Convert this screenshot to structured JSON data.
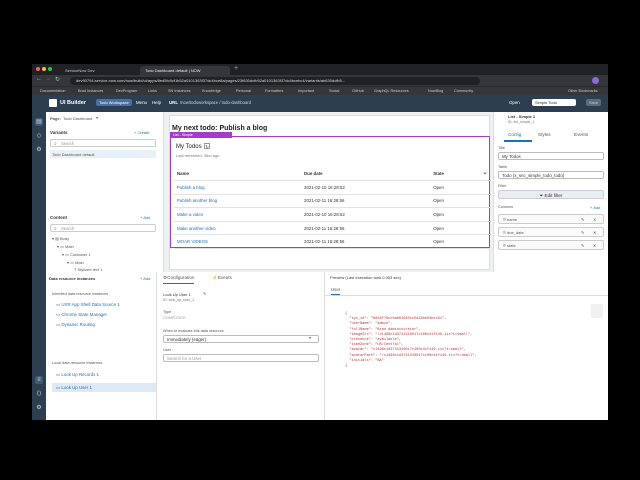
{
  "browser": {
    "tabs": [
      "ServiceNow Dev",
      "Todo Dashboard default | NOW"
    ],
    "url": "dev90794.service-now.com/now/build/ui/apps/8ed5fc9cf1b52a0101363f37dc4bce8a/pages/23f630dcfb52a0101363f37dc4bcebc4/variants/ab630dcfb5...",
    "bookmarks": [
      "Documentation",
      "Brad Instances",
      "DevProgram",
      "Links",
      "SN Instances",
      "Knowledge",
      "Personal",
      "Formatters",
      "Important",
      "Social",
      "GitHub",
      "GraphQL Resources",
      "NowBlog",
      "Community"
    ],
    "other_bookmarks": "Other Bookmarks"
  },
  "app": {
    "title": "UI Builder",
    "workspace": "Todo Workspace",
    "menu": "Menu",
    "help": "Help",
    "url_label": "URL",
    "url_value": "/now/todoworkspace / todo-dashboard",
    "open": "Open",
    "variant": "Simple Todo",
    "save": "Save"
  },
  "left": {
    "page_label": "Page:",
    "page_value": "Todo Dashboard",
    "variants": "Variants",
    "create": "+ Create",
    "search": "Search",
    "variant_item": "Todo Dashboard default",
    "content": "Content",
    "add": "+ Add",
    "tree": [
      "Body",
      "Main",
      "Container 1",
      "Main",
      "Stylized text 1"
    ]
  },
  "canvas": {
    "heading": "My next todo:  Publish a blog",
    "badge": "List - Simple",
    "list_title": "My Todos",
    "refreshed": "Last refreshed: 35m ago",
    "columns": [
      "Name",
      "Due date",
      "State"
    ],
    "rows": [
      [
        "Publish a blog",
        "2021-02-10 16:28:52",
        "Open"
      ],
      [
        "Publish another blog",
        "2021-02-11 16:28:56",
        "Open"
      ],
      [
        "Make a video",
        "2021-02-10 16:28:52",
        "Open"
      ],
      [
        "Make another video",
        "2021-02-11 16:28:56",
        "Open"
      ],
      [
        "MOAR VIDEOS",
        "2021-02-11 16:28:56",
        "Open"
      ]
    ]
  },
  "config": {
    "component": "List - Simple 1",
    "id": "ID: list_simple_1",
    "tabs": [
      "Config",
      "Styles",
      "Events"
    ],
    "title_label": "Title",
    "title_value": "My Todos",
    "table_label": "Table",
    "table_value": "Todo (x_snc_simple_todo_todo)",
    "filter_label": "Filter",
    "edit_filter": "Edit filter",
    "columns_label": "Columns",
    "add": "+ Add",
    "columns": [
      "name",
      "due_date",
      "state"
    ]
  },
  "data": {
    "title": "Data resource instances",
    "add": "+ Add",
    "inherited": "Inherited data resource instances",
    "inherited_items": [
      "UXR App Shell Data Source 1",
      "Chrome State Manager",
      "Dynamic Routing"
    ],
    "local": "Local data resource instances",
    "local_items": [
      "Look Up Records 1",
      "Look Up User 1"
    ]
  },
  "mid": {
    "tabs": [
      "Configuration",
      "Events"
    ],
    "name": "Look Up User 1",
    "id": "ID: look_up_user_1",
    "type_label": "Type",
    "type_value": "COMPOSITE",
    "when_label": "When to evaluate this data resource",
    "when_value": "Immediately (eager)",
    "user_label": "User",
    "user_placeholder": "Search for a User"
  },
  "preview": {
    "title": "Preview (Last execution took 0.053 sec)",
    "tab": "User",
    "json": "{\n  \"sys_id\": \"6816f79cc0a8016401c5a33be04be441\",\n  \"userName\": \"admin\",\n  \"fullName\": \"Brad Administrator\",\n  \"imageSrc\": \"/c1498c1d3741310017c100c41f149.iix?t=small\",\n  \"presence\": \"available\",\n  \"timeZone\": \"US/Central\",\n  \"avatar\": \"c1498c1d3741310017c100c41f149.iix?t=small\",\n  \"avatarPath\": \"/c1498c1d3741310017c100c41f149.iix?t=small\",\n  \"initials\": \"BA\"\n}"
  }
}
